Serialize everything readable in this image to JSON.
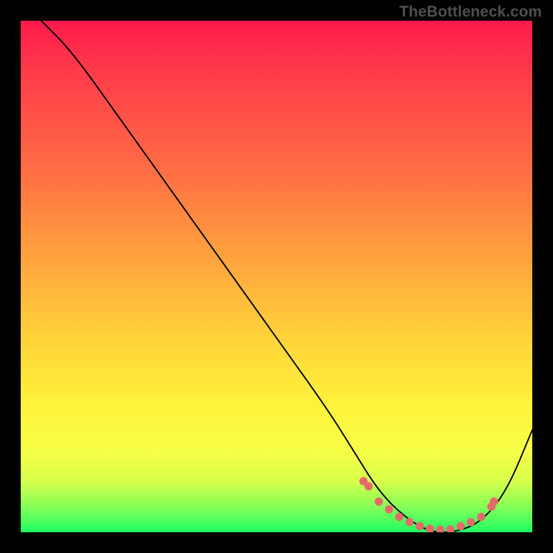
{
  "watermark": "TheBottleneck.com",
  "chart_data": {
    "type": "line",
    "title": "",
    "xlabel": "",
    "ylabel": "",
    "xlim": [
      0,
      100
    ],
    "ylim": [
      0,
      100
    ],
    "grid": false,
    "series": [
      {
        "name": "bottleneck-curve",
        "color": "#000000",
        "x": [
          4,
          10,
          20,
          30,
          40,
          50,
          60,
          65,
          70,
          75,
          80,
          85,
          90,
          95,
          100
        ],
        "values": [
          100,
          94,
          80,
          66,
          52,
          38,
          24,
          16,
          8,
          3,
          0,
          0,
          2,
          8,
          20
        ]
      }
    ],
    "markers": {
      "name": "optimal-range-dots",
      "color": "#e46a6a",
      "x": [
        67,
        68,
        70,
        72,
        74,
        76,
        78,
        80,
        82,
        84,
        86,
        88,
        90,
        92,
        92.5
      ],
      "values": [
        10,
        9,
        6,
        4.5,
        3,
        2,
        1.2,
        0.7,
        0.5,
        0.6,
        1.2,
        2,
        3,
        5,
        6
      ]
    },
    "background": {
      "type": "vertical-gradient",
      "stops": [
        {
          "pos": 0,
          "color": "#ff1a4d"
        },
        {
          "pos": 28,
          "color": "#ff6a45"
        },
        {
          "pos": 62,
          "color": "#ffd33a"
        },
        {
          "pos": 84,
          "color": "#f7ff46"
        },
        {
          "pos": 100,
          "color": "#1eff63"
        }
      ]
    }
  }
}
